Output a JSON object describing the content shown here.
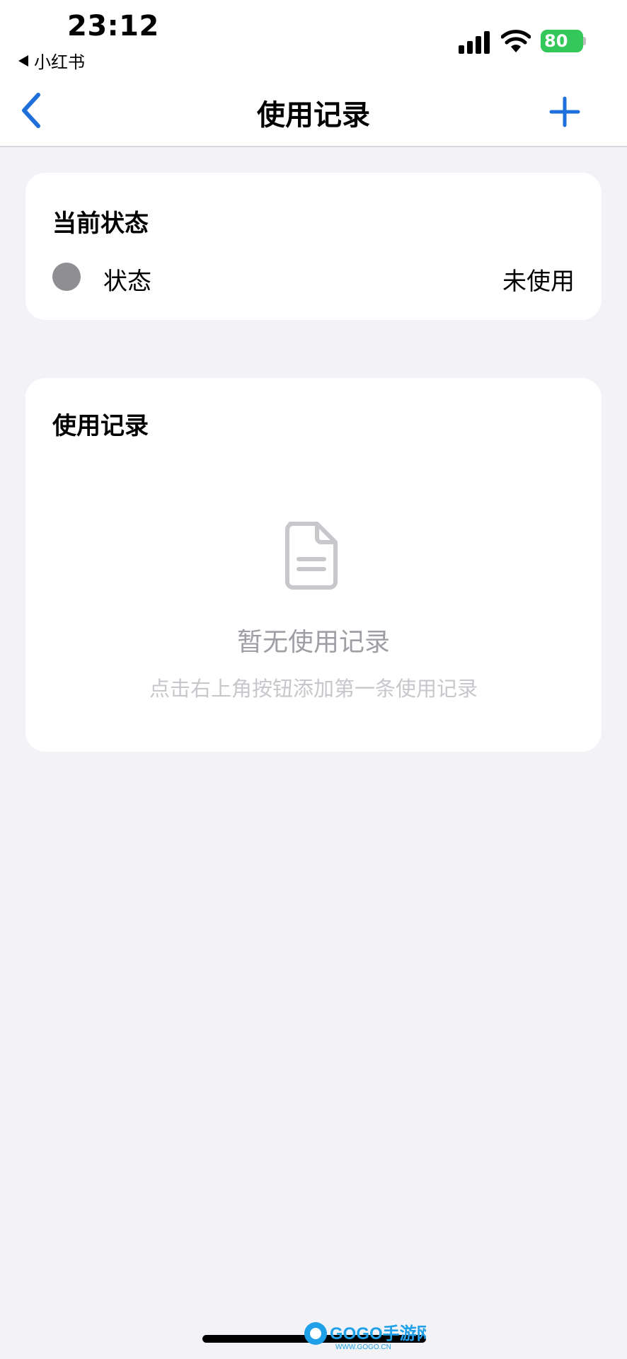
{
  "status_bar": {
    "time": "23:12",
    "back_app": "小红书",
    "battery": "80"
  },
  "nav": {
    "title": "使用记录"
  },
  "current_status": {
    "title": "当前状态",
    "label": "状态",
    "value": "未使用",
    "dot_color": "#8e8e93"
  },
  "records": {
    "title": "使用记录",
    "empty_title": "暂无使用记录",
    "empty_subtitle": "点击右上角按钮添加第一条使用记录"
  },
  "watermark": {
    "brand": "GOGO手游网",
    "url": "WWW.GOGO.CN"
  },
  "colors": {
    "accent": "#1e6fd9",
    "background": "#f2f2f7",
    "battery": "#34c759"
  },
  "icons": [
    "chevron-left-icon",
    "plus-icon",
    "document-icon",
    "signal-icon",
    "wifi-icon"
  ]
}
